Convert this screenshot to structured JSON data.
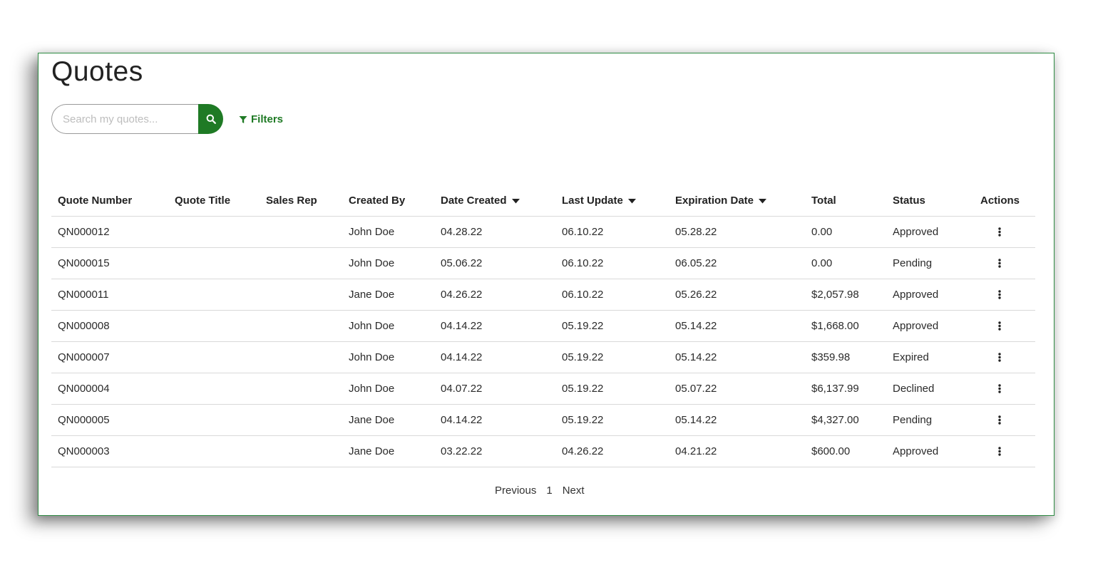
{
  "page": {
    "title": "Quotes"
  },
  "search": {
    "placeholder": "Search my quotes...",
    "value": "",
    "button_icon": "search-icon"
  },
  "filters": {
    "label": "Filters",
    "icon": "filter-icon"
  },
  "colors": {
    "accent": "#1f7a25",
    "border": "#2e8b43"
  },
  "table": {
    "columns": [
      {
        "label": "Quote Number",
        "sortable": false
      },
      {
        "label": "Quote Title",
        "sortable": false
      },
      {
        "label": "Sales Rep",
        "sortable": false
      },
      {
        "label": "Created By",
        "sortable": false
      },
      {
        "label": "Date Created",
        "sortable": true
      },
      {
        "label": "Last Update",
        "sortable": true
      },
      {
        "label": "Expiration Date",
        "sortable": true
      },
      {
        "label": "Total",
        "sortable": false
      },
      {
        "label": "Status",
        "sortable": false
      },
      {
        "label": "Actions",
        "sortable": false
      }
    ],
    "rows": [
      {
        "quote_number": "QN000012",
        "quote_title": "",
        "sales_rep": "",
        "created_by": "John Doe",
        "date_created": "04.28.22",
        "last_update": "06.10.22",
        "expiration_date": "05.28.22",
        "total": "0.00",
        "status": "Approved"
      },
      {
        "quote_number": "QN000015",
        "quote_title": "",
        "sales_rep": "",
        "created_by": "John Doe",
        "date_created": "05.06.22",
        "last_update": "06.10.22",
        "expiration_date": "06.05.22",
        "total": "0.00",
        "status": "Pending"
      },
      {
        "quote_number": "QN000011",
        "quote_title": "",
        "sales_rep": "",
        "created_by": "Jane Doe",
        "date_created": "04.26.22",
        "last_update": "06.10.22",
        "expiration_date": "05.26.22",
        "total": "$2,057.98",
        "status": "Approved"
      },
      {
        "quote_number": "QN000008",
        "quote_title": "",
        "sales_rep": "",
        "created_by": "John Doe",
        "date_created": "04.14.22",
        "last_update": "05.19.22",
        "expiration_date": "05.14.22",
        "total": "$1,668.00",
        "status": "Approved"
      },
      {
        "quote_number": "QN000007",
        "quote_title": "",
        "sales_rep": "",
        "created_by": "John Doe",
        "date_created": "04.14.22",
        "last_update": "05.19.22",
        "expiration_date": "05.14.22",
        "total": "$359.98",
        "status": "Expired"
      },
      {
        "quote_number": "QN000004",
        "quote_title": "",
        "sales_rep": "",
        "created_by": "John Doe",
        "date_created": "04.07.22",
        "last_update": "05.19.22",
        "expiration_date": "05.07.22",
        "total": "$6,137.99",
        "status": "Declined"
      },
      {
        "quote_number": "QN000005",
        "quote_title": "",
        "sales_rep": "",
        "created_by": "Jane Doe",
        "date_created": "04.14.22",
        "last_update": "05.19.22",
        "expiration_date": "05.14.22",
        "total": "$4,327.00",
        "status": "Pending"
      },
      {
        "quote_number": "QN000003",
        "quote_title": "",
        "sales_rep": "",
        "created_by": "Jane Doe",
        "date_created": "03.22.22",
        "last_update": "04.26.22",
        "expiration_date": "04.21.22",
        "total": "$600.00",
        "status": "Approved"
      }
    ],
    "row_action_icon": "more-vertical-icon",
    "sort_icon": "caret-down-icon"
  },
  "pagination": {
    "previous_label": "Previous",
    "current_page": "1",
    "next_label": "Next"
  }
}
